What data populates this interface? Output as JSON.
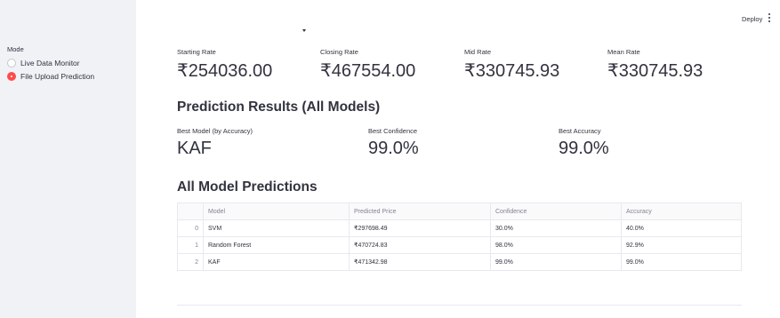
{
  "header": {
    "deploy_label": "Deploy",
    "menu_icon": "kebab-menu-icon"
  },
  "sidebar": {
    "mode_label": "Mode",
    "options": [
      {
        "label": "Live Data Monitor",
        "selected": false
      },
      {
        "label": "File Upload Prediction",
        "selected": true
      }
    ],
    "accent_color": "#ff4b4b"
  },
  "rates": {
    "starting": {
      "label": "Starting Rate",
      "value": "₹254036.00"
    },
    "closing": {
      "label": "Closing Rate",
      "value": "₹467554.00"
    },
    "mid": {
      "label": "Mid Rate",
      "value": "₹330745.93"
    },
    "mean": {
      "label": "Mean Rate",
      "value": "₹330745.93"
    }
  },
  "prediction_results": {
    "title": "Prediction Results (All Models)",
    "best_model": {
      "label": "Best Model (by Accuracy)",
      "value": "KAF"
    },
    "best_confidence": {
      "label": "Best Confidence",
      "value": "99.0%"
    },
    "best_accuracy": {
      "label": "Best Accuracy",
      "value": "99.0%"
    }
  },
  "all_models": {
    "title": "All Model Predictions",
    "columns": [
      "",
      "Model",
      "Predicted Price",
      "Confidence",
      "Accuracy"
    ],
    "rows": [
      {
        "index": "0",
        "model": "SVM",
        "price": "₹297698.49",
        "confidence": "30.0%",
        "accuracy": "40.0%"
      },
      {
        "index": "1",
        "model": "Random Forest",
        "price": "₹470724.83",
        "confidence": "98.0%",
        "accuracy": "92.9%"
      },
      {
        "index": "2",
        "model": "KAF",
        "price": "₹471342.98",
        "confidence": "99.0%",
        "accuracy": "99.0%"
      }
    ]
  }
}
